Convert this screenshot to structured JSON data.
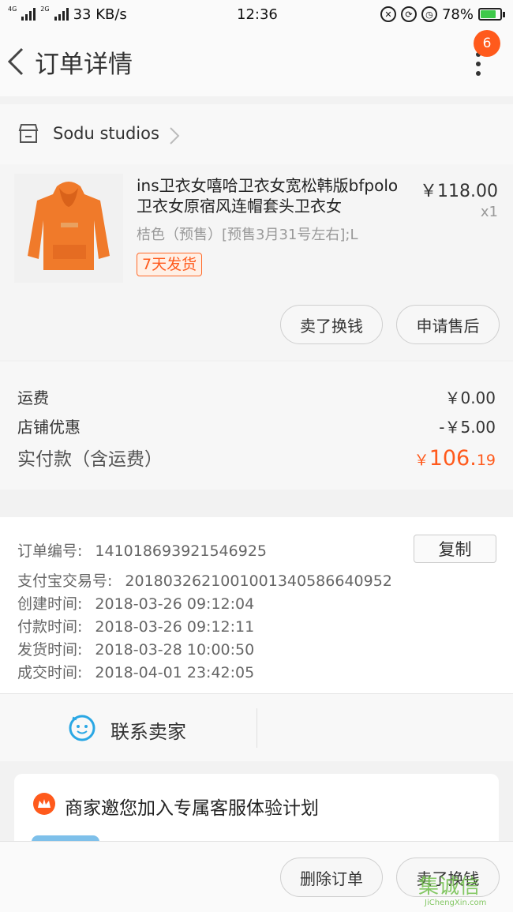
{
  "status_bar": {
    "network_type_1": "4G",
    "network_type_2": "2G",
    "speed": "33 KB/s",
    "time": "12:36",
    "battery": "78%",
    "battery_level": 0.78
  },
  "nav": {
    "title": "订单详情",
    "notification_count": "6"
  },
  "shop": {
    "name": "Sodu studios"
  },
  "item": {
    "title": "ins卫衣女嘻哈卫衣女宽松韩版bfpolo卫衣女原宿风连帽套头卫衣女",
    "sku": "桔色（预售）[预售3月31号左右];L",
    "tag": "7天发货",
    "price": "￥118.00",
    "quantity": "x1",
    "buttons": {
      "sell": "卖了换钱",
      "after_sale": "申请售后"
    }
  },
  "fees": {
    "shipping_label": "运费",
    "shipping_value": "￥0.00",
    "discount_label": "店铺优惠",
    "discount_value": "-￥5.00",
    "total_label": "实付款（含运费）",
    "total_currency": "￥",
    "total_int": "106.",
    "total_dec": "19"
  },
  "order_info": {
    "copy_button": "复制",
    "rows": [
      {
        "label": "订单编号:",
        "value": "141018693921546925"
      },
      {
        "label": "支付宝交易号:",
        "value": "2018032621001001340586640952"
      },
      {
        "label": "创建时间:",
        "value": "2018-03-26 09:12:04"
      },
      {
        "label": "付款时间:",
        "value": "2018-03-26 09:12:11"
      },
      {
        "label": "发货时间:",
        "value": "2018-03-28 10:00:50"
      },
      {
        "label": "成交时间:",
        "value": "2018-04-01 23:42:05"
      }
    ]
  },
  "contact": {
    "label": "联系卖家"
  },
  "promo": {
    "text": "商家邀您加入专属客服体验计划"
  },
  "bottom_bar": {
    "delete": "删除订单",
    "sell": "卖了换钱"
  },
  "watermark": {
    "main": "集诚信",
    "sub": "JiChengXin.com"
  },
  "colors": {
    "accent": "#ff5a1c",
    "battery_fill": "#3ec94a"
  }
}
